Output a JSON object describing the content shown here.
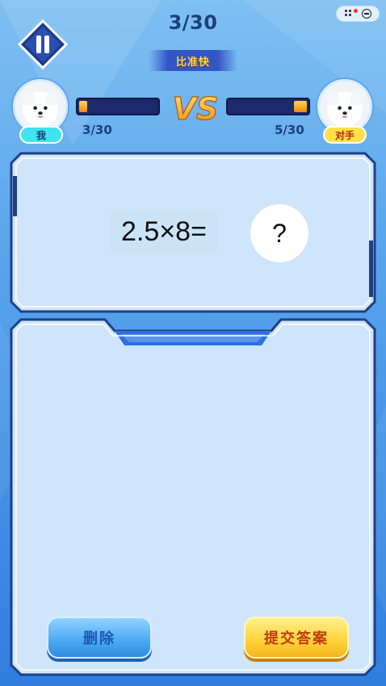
{
  "header": {
    "progress_counter": "3/30",
    "mode_label": "比准快"
  },
  "players": {
    "me": {
      "tag": "我",
      "score": "3/30",
      "progress": 0.1
    },
    "opponent": {
      "tag": "对手",
      "score": "5/30",
      "progress": 0.167
    }
  },
  "vs_label": "VS",
  "question": {
    "equation": "2.5×8=",
    "answer_placeholder": "?"
  },
  "actions": {
    "delete_label": "删除",
    "submit_label": "提交答案"
  },
  "colors": {
    "accent_blue": "#2f7ee0",
    "delete_button": "#4aa8f2",
    "submit_button": "#ffd23a",
    "panel_fill": "#cfe5fb",
    "panel_border": "#1f3f86"
  },
  "icons": {
    "pause": "pause-icon",
    "more": "more-dots-icon",
    "close": "close-circle-icon"
  }
}
